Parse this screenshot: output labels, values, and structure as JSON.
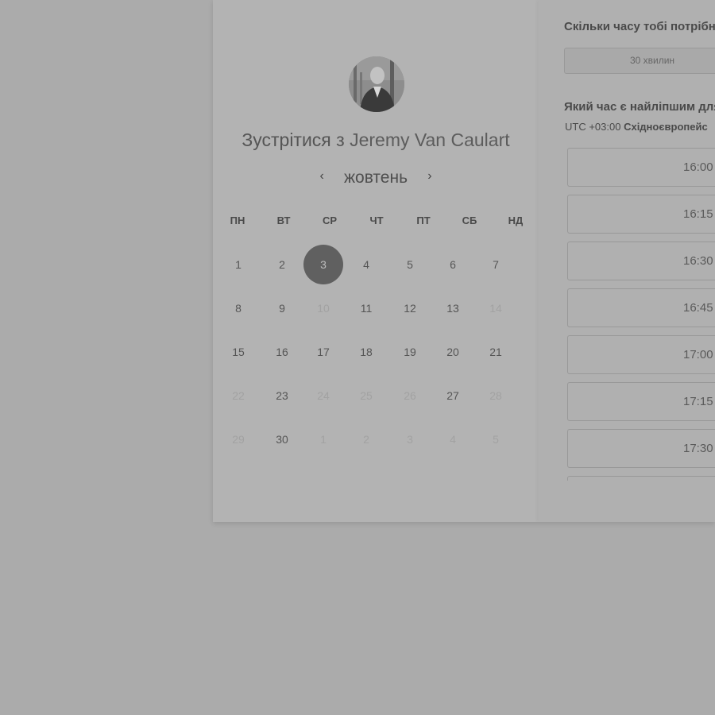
{
  "host": {
    "title_prefix": "Зустрітися з",
    "title_name": "Jeremy Van Caulart"
  },
  "calendar": {
    "month": "жовтень",
    "prev_icon": "chevron-left-icon",
    "next_icon": "chevron-right-icon",
    "prev_glyph": "‹",
    "next_glyph": "›",
    "weekdays": [
      "ПН",
      "ВТ",
      "СР",
      "ЧТ",
      "ПТ",
      "СБ",
      "НД"
    ],
    "weeks": [
      [
        {
          "d": "1",
          "dim": false
        },
        {
          "d": "2",
          "dim": false
        },
        {
          "d": "3",
          "dim": false,
          "selected": true
        },
        {
          "d": "4",
          "dim": false
        },
        {
          "d": "5",
          "dim": false
        },
        {
          "d": "6",
          "dim": false
        },
        {
          "d": "7",
          "dim": false
        }
      ],
      [
        {
          "d": "8",
          "dim": false
        },
        {
          "d": "9",
          "dim": false
        },
        {
          "d": "10",
          "dim": true
        },
        {
          "d": "11",
          "dim": false
        },
        {
          "d": "12",
          "dim": false
        },
        {
          "d": "13",
          "dim": false
        },
        {
          "d": "14",
          "dim": true
        }
      ],
      [
        {
          "d": "15",
          "dim": false
        },
        {
          "d": "16",
          "dim": false
        },
        {
          "d": "17",
          "dim": false
        },
        {
          "d": "18",
          "dim": false
        },
        {
          "d": "19",
          "dim": false
        },
        {
          "d": "20",
          "dim": false
        },
        {
          "d": "21",
          "dim": false
        }
      ],
      [
        {
          "d": "22",
          "dim": true
        },
        {
          "d": "23",
          "dim": false
        },
        {
          "d": "24",
          "dim": true
        },
        {
          "d": "25",
          "dim": true
        },
        {
          "d": "26",
          "dim": true
        },
        {
          "d": "27",
          "dim": false
        },
        {
          "d": "28",
          "dim": true
        }
      ],
      [
        {
          "d": "29",
          "dim": true
        },
        {
          "d": "30",
          "dim": false
        },
        {
          "d": "1",
          "dim": true
        },
        {
          "d": "2",
          "dim": true
        },
        {
          "d": "3",
          "dim": true
        },
        {
          "d": "4",
          "dim": true
        },
        {
          "d": "5",
          "dim": true
        }
      ]
    ],
    "selected_color": "#606060"
  },
  "booking": {
    "duration_question": "Скільки часу тобі потрібн",
    "duration_value": "30 хвилин",
    "time_question": "Який час є найліпшим для",
    "timezone_offset": "UTC +03:00",
    "timezone_name": "Східноєвропейс",
    "slots": [
      "16:00",
      "16:15",
      "16:30",
      "16:45",
      "17:00",
      "17:15",
      "17:30",
      ""
    ]
  }
}
